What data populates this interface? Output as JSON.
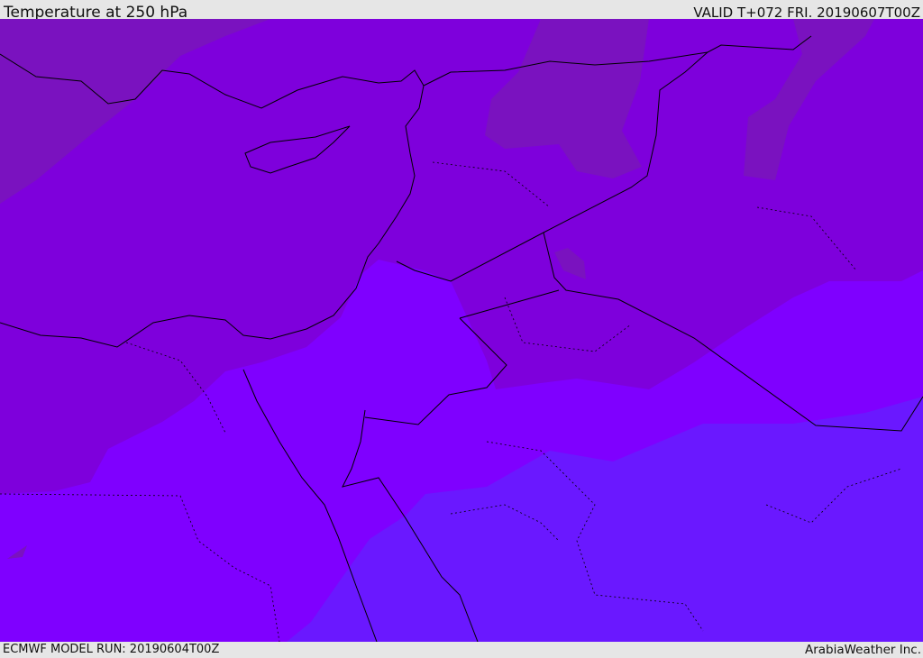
{
  "header": {
    "title": "Temperature at 250 hPa",
    "valid": "VALID T+072 FRI. 20190607T00Z"
  },
  "footer": {
    "model_run": "ECMWF MODEL RUN: 20190604T00Z",
    "credit": "ArabiaWeather Inc."
  },
  "map": {
    "colors": {
      "coldest": "#7a12bf",
      "cold": "#7e00dc",
      "mid": "#7f00ff",
      "warm": "#6a18ff",
      "borders": "#000000"
    }
  }
}
